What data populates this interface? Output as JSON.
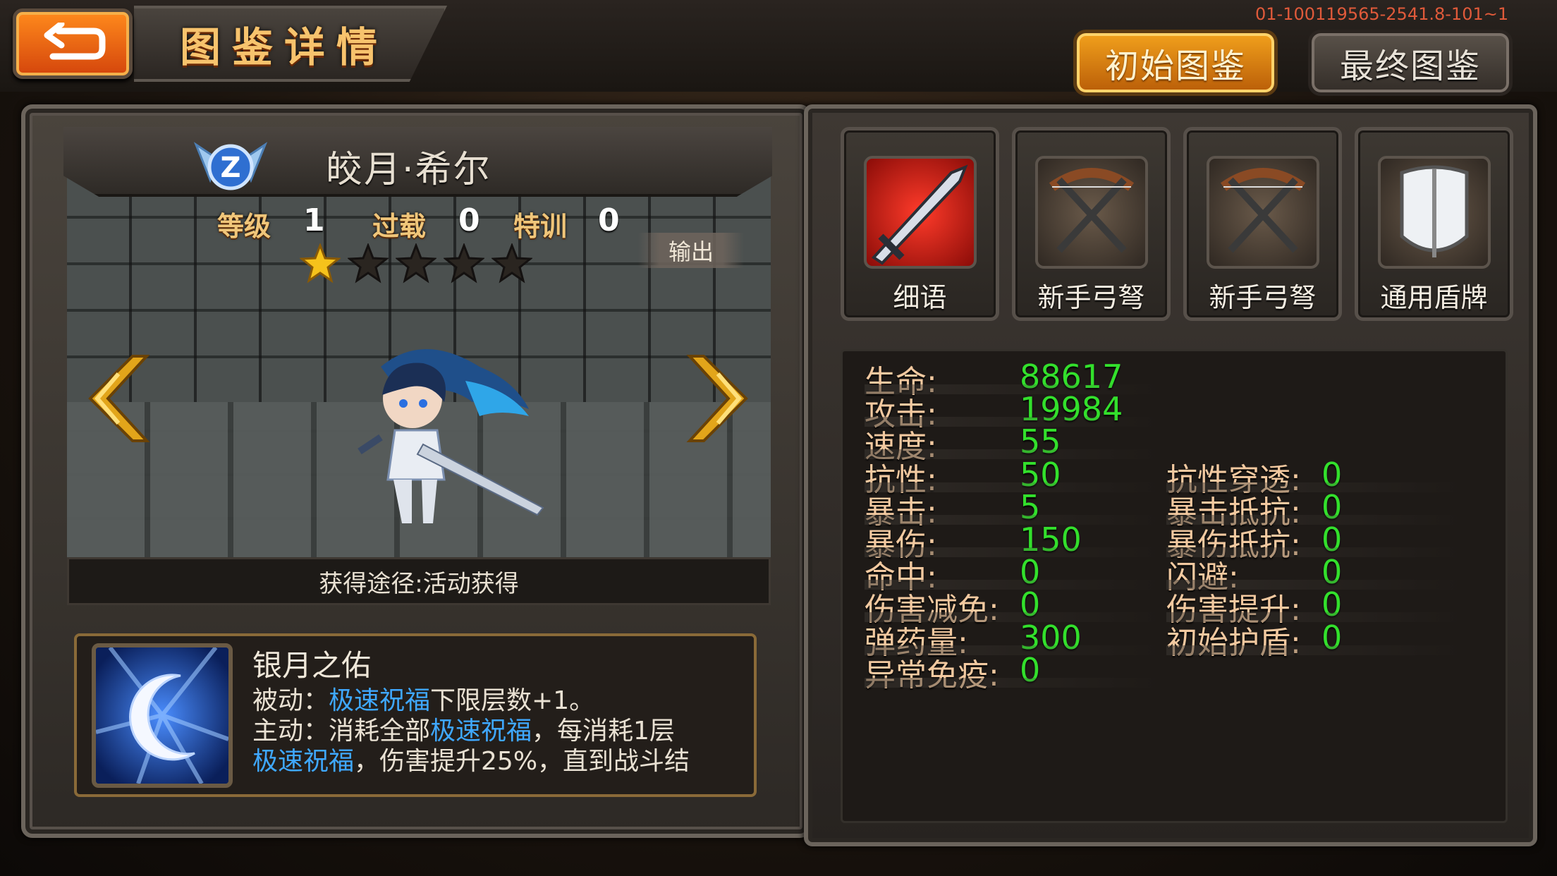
{
  "header": {
    "title": "图鉴详情",
    "version": "01-100119565-2541.8-101~1",
    "tabs": [
      {
        "label": "初始图鉴",
        "active": true
      },
      {
        "label": "最终图鉴",
        "active": false
      }
    ]
  },
  "hero": {
    "name": "皎月·希尔",
    "rank_badge": "Z",
    "level_label": "等级",
    "level": "1",
    "overload_label": "过载",
    "overload": "0",
    "training_label": "特训",
    "training": "0",
    "stars_filled": 1,
    "stars_total": 5,
    "role": "输出",
    "source": "获得途径:活动获得"
  },
  "skill": {
    "name": "银月之佑",
    "passive_prefix": "被动：",
    "passive_highlight": "极速祝福",
    "passive_suffix": "下限层数+1。",
    "active_prefix": "主动：消耗全部",
    "active_highlight1": "极速祝福",
    "active_mid": "，每消耗1层",
    "active_highlight2": "极速祝福",
    "active_suffix": "，伤害提升25%，直到战斗结"
  },
  "equipment": [
    {
      "label": "细语",
      "icon": "blade-icon"
    },
    {
      "label": "新手弓弩",
      "icon": "crossbow-icon"
    },
    {
      "label": "新手弓弩",
      "icon": "crossbow-icon"
    },
    {
      "label": "通用盾牌",
      "icon": "shield-icon"
    }
  ],
  "stats": {
    "left": [
      {
        "label": "生命:",
        "value": "88617"
      },
      {
        "label": "攻击:",
        "value": "19984"
      },
      {
        "label": "速度:",
        "value": "55"
      },
      {
        "label": "抗性:",
        "value": "50"
      },
      {
        "label": "暴击:",
        "value": "5"
      },
      {
        "label": "暴伤:",
        "value": "150"
      },
      {
        "label": "命中:",
        "value": "0"
      },
      {
        "label": "伤害减免:",
        "value": "0"
      },
      {
        "label": "弹药量:",
        "value": "300"
      },
      {
        "label": "异常免疫:",
        "value": "0"
      }
    ],
    "right": [
      {
        "label": "抗性穿透:",
        "value": "0"
      },
      {
        "label": "暴击抵抗:",
        "value": "0"
      },
      {
        "label": "暴伤抵抗:",
        "value": "0"
      },
      {
        "label": "闪避:",
        "value": "0"
      },
      {
        "label": "伤害提升:",
        "value": "0"
      },
      {
        "label": "初始护盾:",
        "value": "0"
      }
    ]
  },
  "colors": {
    "stat_label": "#f2c9a0",
    "stat_value": "#33e02c",
    "skill_highlight": "#3fa8ff",
    "tab_active": "#f2a11c"
  }
}
